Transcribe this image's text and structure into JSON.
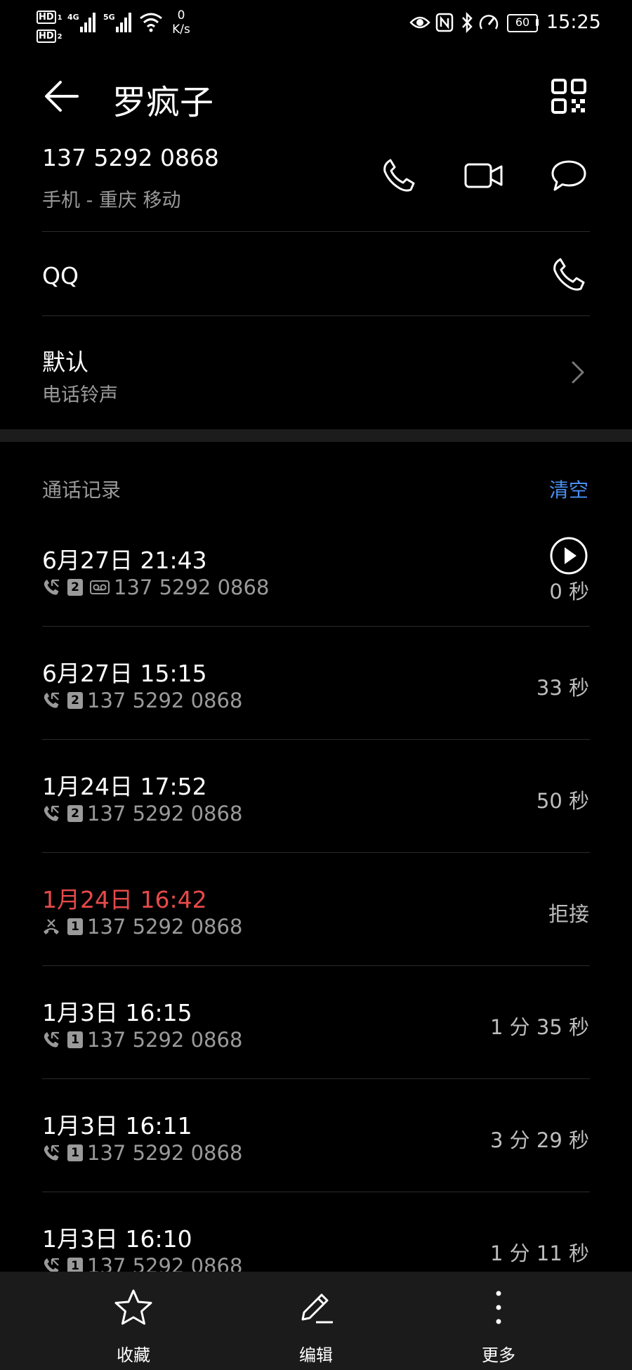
{
  "status_bar": {
    "hd1": "HD",
    "hd1_sub": "1",
    "hd2": "HD",
    "hd2_sub": "2",
    "net1": "4G",
    "net2": "5G",
    "speed_value": "0",
    "speed_unit": "K/s",
    "battery": "60",
    "time": "15:25"
  },
  "header": {
    "contact_name": "罗疯子"
  },
  "contact": {
    "phone_number": "137 5292 0868",
    "phone_sub": "手机 - 重庆 移动",
    "qq_label": "QQ",
    "ringtone_value": "默认",
    "ringtone_label": "电话铃声"
  },
  "call_log": {
    "title": "通话记录",
    "clear_label": "清空",
    "entries": [
      {
        "date": "6月27日 21:43",
        "sim": "2",
        "number": "137 5292 0868",
        "duration": "0 秒",
        "type": "incoming",
        "voicemail": true
      },
      {
        "date": "6月27日 15:15",
        "sim": "2",
        "number": "137 5292 0868",
        "duration": "33 秒",
        "type": "incoming"
      },
      {
        "date": "1月24日 17:52",
        "sim": "2",
        "number": "137 5292 0868",
        "duration": "50 秒",
        "type": "incoming"
      },
      {
        "date": "1月24日 16:42",
        "sim": "1",
        "number": "137 5292 0868",
        "duration": "拒接",
        "type": "rejected"
      },
      {
        "date": "1月3日 16:15",
        "sim": "1",
        "number": "137 5292 0868",
        "duration": "1 分 35 秒",
        "type": "incoming"
      },
      {
        "date": "1月3日 16:11",
        "sim": "1",
        "number": "137 5292 0868",
        "duration": "3 分 29 秒",
        "type": "incoming"
      },
      {
        "date": "1月3日 16:10",
        "sim": "1",
        "number": "137 5292 0868",
        "duration": "1 分 11 秒",
        "type": "incoming"
      }
    ]
  },
  "bottom_bar": {
    "favorite_label": "收藏",
    "edit_label": "编辑",
    "more_label": "更多"
  },
  "colors": {
    "background": "#000000",
    "accent_blue": "#4a8ff0",
    "missed_red": "#e64a4a",
    "secondary_text": "#9a9a9a"
  }
}
